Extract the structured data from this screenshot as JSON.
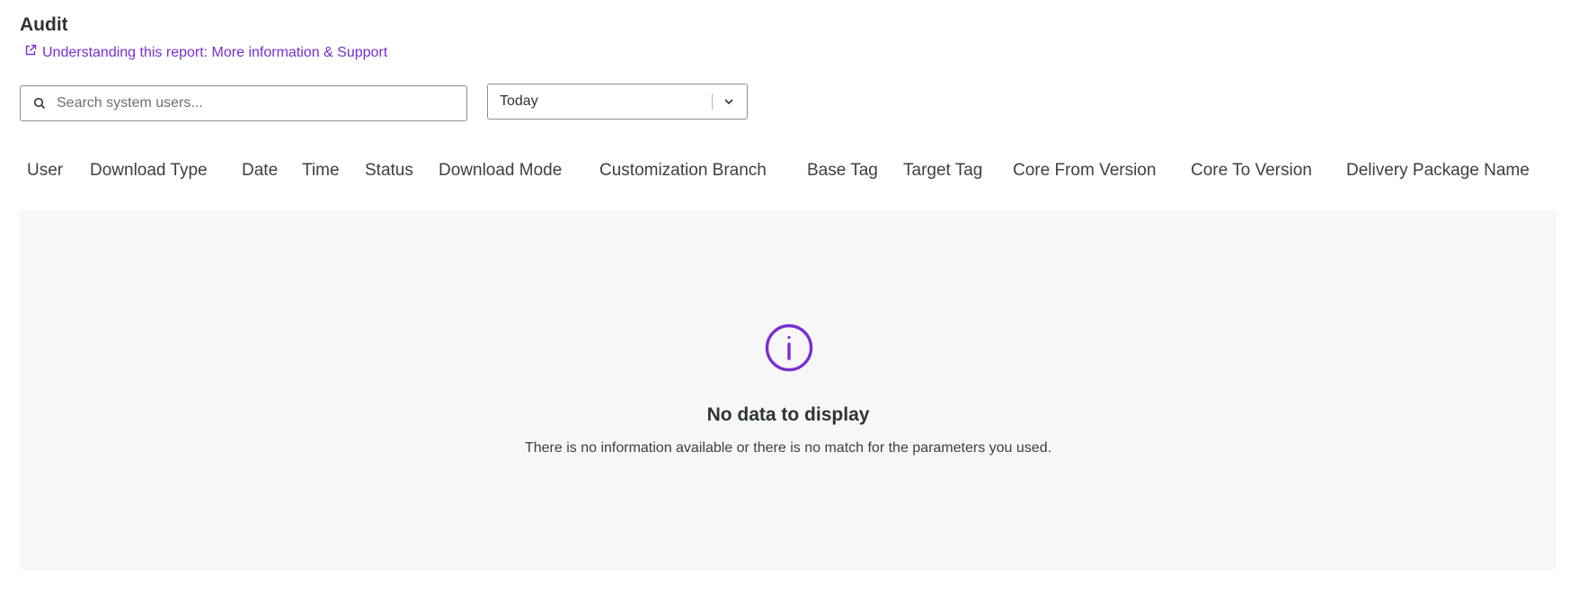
{
  "page": {
    "title": "Audit",
    "help_link": "Understanding this report: More information & Support"
  },
  "search": {
    "placeholder": "Search system users...",
    "value": ""
  },
  "date_filter": {
    "selected": "Today"
  },
  "table": {
    "columns": [
      "User",
      "Download Type",
      "Date",
      "Time",
      "Status",
      "Download Mode",
      "Customization Branch",
      "Base Tag",
      "Target Tag",
      "Core From Version",
      "Core To Version",
      "Delivery Package Name"
    ]
  },
  "empty_state": {
    "title": "No data to display",
    "message": "There is no information available or there is no match for the parameters you used."
  },
  "colors": {
    "accent": "#7b2dd1",
    "text": "#2e3338",
    "panel": "#f7f7f7"
  },
  "icons": [
    "external-link-icon",
    "search-icon",
    "chevron-down-icon",
    "info-circle-icon"
  ]
}
